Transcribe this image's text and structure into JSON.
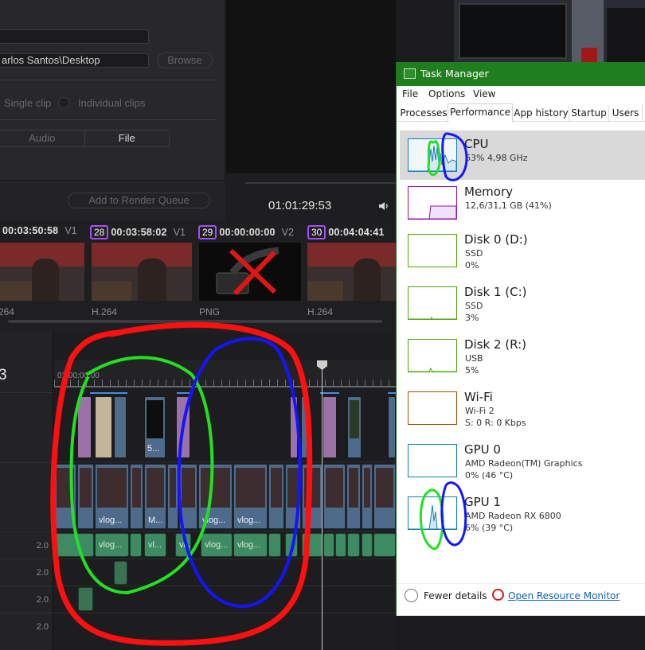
{
  "render_settings": {
    "location_value": "arlos Santos\\Desktop",
    "browse_label": "Browse",
    "single_clip_label": "Single clip",
    "individual_clips_label": "Individual clips",
    "audio_tab": "Audio",
    "file_tab": "File",
    "add_to_queue_label": "Add to Render Queue"
  },
  "viewer": {
    "timecode": "01:01:29:53"
  },
  "clip_strip": {
    "clips": [
      {
        "num": "",
        "timecode": "00:03:50:58",
        "track": "V1",
        "codec": "264"
      },
      {
        "num": "28",
        "timecode": "00:03:58:02",
        "track": "V1",
        "codec": "H.264"
      },
      {
        "num": "29",
        "timecode": "00:00:00:00",
        "track": "V2",
        "codec": "PNG"
      },
      {
        "num": "30",
        "timecode": "00:04:04:41",
        "track": "",
        "codec": "H.264"
      }
    ]
  },
  "timeline": {
    "current_tc_fragment": "3",
    "ruler_tc": "01:00:00:00",
    "audio_levels": [
      "2.0",
      "2.0",
      "2.0",
      "2.0"
    ],
    "v2_clip_label": "5...",
    "v1_labels": [
      "vlog...",
      "M...",
      "vlog...",
      "vlog..."
    ],
    "a1_labels": [
      "vlog...",
      "vl...",
      "vl...",
      "vlog...",
      "vlog..."
    ]
  },
  "task_manager": {
    "title": "Task Manager",
    "menu": [
      "File",
      "Options",
      "View"
    ],
    "tabs": [
      "Processes",
      "Performance",
      "App history",
      "Startup",
      "Users"
    ],
    "active_tab": "Performance",
    "items": [
      {
        "name": "CPU",
        "line1": "63% 4,98 GHz",
        "line2": "",
        "color": "#117dbb"
      },
      {
        "name": "Memory",
        "line1": "12,6/31,1 GB (41%)",
        "line2": "",
        "color": "#8b12ae"
      },
      {
        "name": "Disk 0 (D:)",
        "line1": "SSD",
        "line2": "0%",
        "color": "#4da60c"
      },
      {
        "name": "Disk 1 (C:)",
        "line1": "SSD",
        "line2": "3%",
        "color": "#4da60c"
      },
      {
        "name": "Disk 2 (R:)",
        "line1": "USB",
        "line2": "5%",
        "color": "#4da60c"
      },
      {
        "name": "Wi-Fi",
        "line1": "Wi-Fi 2",
        "line2": "S: 0 R: 0 Kbps",
        "color": "#a74f01"
      },
      {
        "name": "GPU 0",
        "line1": "AMD Radeon(TM) Graphics",
        "line2": "0% (46 °C)",
        "color": "#117dbb"
      },
      {
        "name": "GPU 1",
        "line1": "AMD Radeon RX 6800",
        "line2": "6% (39 °C)",
        "color": "#117dbb"
      }
    ],
    "fewer_details": "Fewer details",
    "open_resource_monitor": "Open Resource Monitor"
  },
  "annotation_colors": {
    "red": "#ff1010",
    "green": "#22e022",
    "blue": "#1414ff"
  }
}
